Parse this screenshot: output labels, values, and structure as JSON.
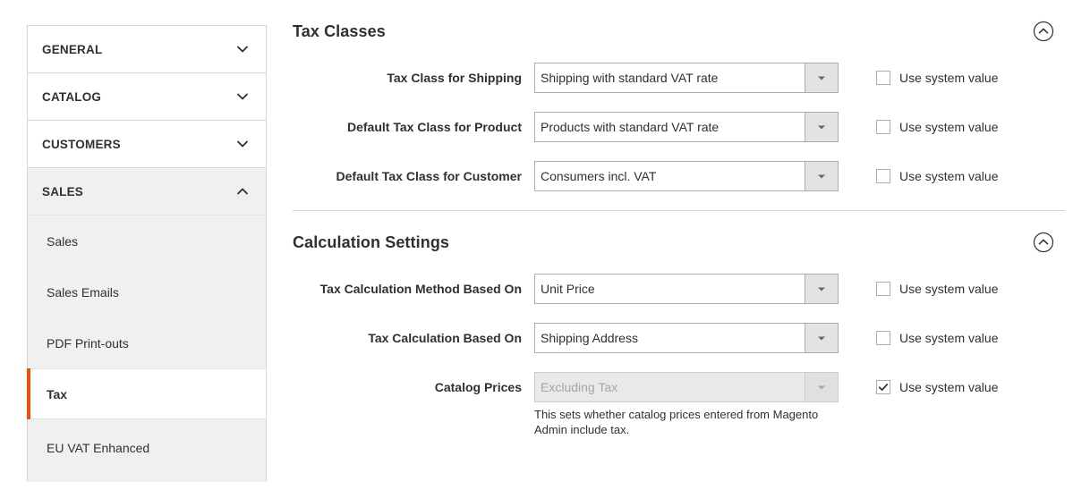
{
  "sidebar": {
    "sections": [
      {
        "label": "GENERAL",
        "icon": "chevron-down-icon",
        "expanded": false
      },
      {
        "label": "CATALOG",
        "icon": "chevron-down-icon",
        "expanded": false
      },
      {
        "label": "CUSTOMERS",
        "icon": "chevron-down-icon",
        "expanded": false
      },
      {
        "label": "SALES",
        "icon": "chevron-up-icon",
        "expanded": true
      }
    ],
    "items": [
      {
        "label": "Sales",
        "current": false
      },
      {
        "label": "Sales Emails",
        "current": false
      },
      {
        "label": "PDF Print-outs",
        "current": false
      },
      {
        "label": "Tax",
        "current": true
      },
      {
        "label": "EU VAT Enhanced",
        "current": false
      }
    ],
    "active_color": "#eb5202"
  },
  "main": {
    "sections": [
      {
        "title": "Tax Classes",
        "collapse_icon": "chevron-up-circle-icon",
        "rows": [
          {
            "label": "Tax Class for Shipping",
            "value": "Shipping with standard VAT rate",
            "disabled": false,
            "system_value_label": "Use system value",
            "system_value_checked": false,
            "help": ""
          },
          {
            "label": "Default Tax Class for Product",
            "value": "Products with standard VAT rate",
            "disabled": false,
            "system_value_label": "Use system value",
            "system_value_checked": false,
            "help": ""
          },
          {
            "label": "Default Tax Class for Customer",
            "value": "Consumers incl. VAT",
            "disabled": false,
            "system_value_label": "Use system value",
            "system_value_checked": false,
            "help": ""
          }
        ]
      },
      {
        "title": "Calculation Settings",
        "collapse_icon": "chevron-up-circle-icon",
        "rows": [
          {
            "label": "Tax Calculation Method Based On",
            "value": "Unit Price",
            "disabled": false,
            "system_value_label": "Use system value",
            "system_value_checked": false,
            "help": ""
          },
          {
            "label": "Tax Calculation Based On",
            "value": "Shipping Address",
            "disabled": false,
            "system_value_label": "Use system value",
            "system_value_checked": false,
            "help": ""
          },
          {
            "label": "Catalog Prices",
            "value": "Excluding Tax",
            "disabled": true,
            "system_value_label": "Use system value",
            "system_value_checked": true,
            "help": "This sets whether catalog prices entered from Magento Admin include tax."
          }
        ]
      }
    ]
  }
}
